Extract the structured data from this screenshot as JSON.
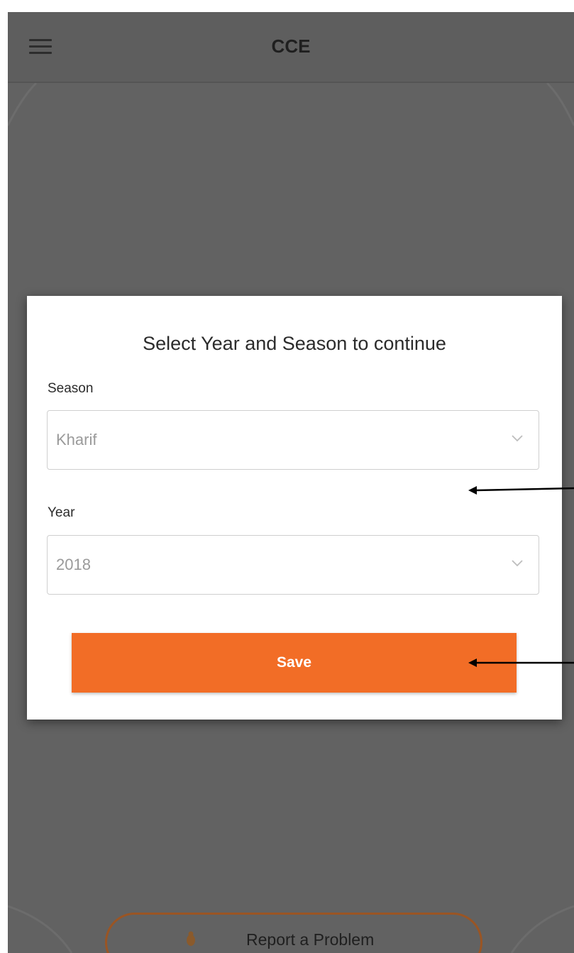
{
  "app_bar": {
    "title": "CCE",
    "menu_icon": "hamburger-menu-icon"
  },
  "dialog": {
    "title": "Select Year and Season to continue",
    "season": {
      "label": "Season",
      "selected": "Kharif"
    },
    "year": {
      "label": "Year",
      "selected": "2018"
    },
    "save_label": "Save"
  },
  "footer": {
    "report_label": "Report a Problem",
    "report_icon": "bug-icon"
  },
  "colors": {
    "accent": "#f26d26",
    "overlay": "#626262",
    "report_border": "#9a5524"
  }
}
